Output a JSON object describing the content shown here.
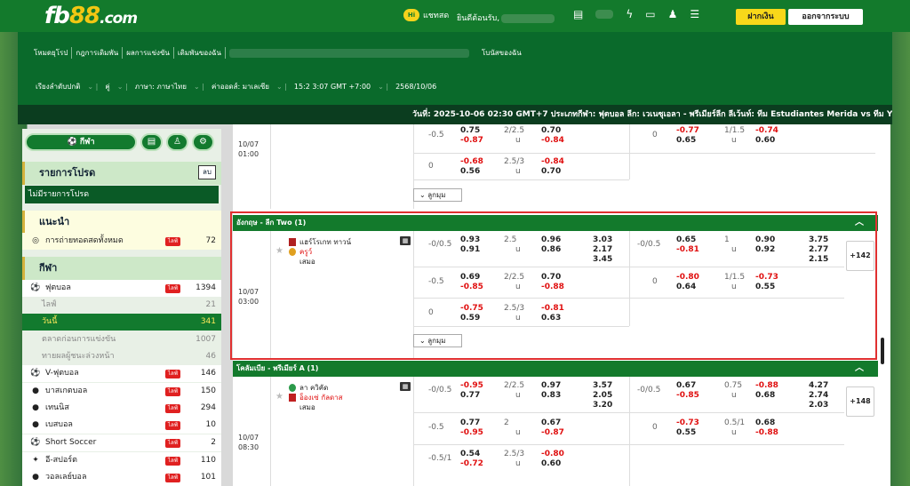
{
  "topbar": {
    "logo_a": "fb",
    "logo_b": "88",
    "logo_c": ".com",
    "chat_label": "แชทสด",
    "chat_badge": "Hi",
    "welcome": "ยินดีต้อนรับ,",
    "deposit": "ฝากเงิน",
    "logout": "ออกจากระบบ"
  },
  "nav": {
    "items": [
      "โหมดยุโรป",
      "กฎการเดิมพัน",
      "ผลการแข่งขัน",
      "เดิมพันของฉัน"
    ],
    "mybets": "โบนัสของฉัน"
  },
  "settings": {
    "sort": "เรียงลำดับปกติ",
    "pair": "คู่",
    "lang": "ภาษา: ภาษาไทย",
    "odds": "ค่าออดส์: มาเลเซีย",
    "clock": "15:2 3:07 GMT +7:00",
    "date": "2568/10/06"
  },
  "ticker": "วันที่: 2025-10-06 02:30 GMT+7 ประเภทกีฬา: ฟุตบอล ลีก: เวเนซุเอลา - พรีเมียร์ลีก ลีเว้นท์: ทีม Estudiantes Merida vs ทีม Yaracuyanos",
  "sidebar": {
    "sport_btn": "กีฬา",
    "fav_title": "รายการโปรด",
    "fav_clear": "ลบ",
    "fav_empty": "ไม่มีรายการโปรด",
    "rec_title": "แนะนำ",
    "rec_item": "การถ่ายทอดสดทั้งหมด",
    "rec_count": "72",
    "live": "ไลฟ์",
    "sports_title": "กีฬา",
    "sports": [
      {
        "name": "ฟุตบอล",
        "count": "1394",
        "live": true,
        "icon": "⚽"
      },
      {
        "name": "ไลฟ์",
        "count": "21",
        "sub": true
      },
      {
        "name": "วันนี้",
        "count": "341",
        "sub": true,
        "active": true
      },
      {
        "name": "ตลาดก่อนการแข่งขัน",
        "count": "1007",
        "sub": true
      },
      {
        "name": "ทายผลผู้ชนะล่วงหน้า",
        "count": "46",
        "sub": true
      },
      {
        "name": "V-ฟุตบอล",
        "count": "146",
        "live": true,
        "icon": "⚽"
      },
      {
        "name": "บาสเกตบอล",
        "count": "150",
        "live": true,
        "icon": "●"
      },
      {
        "name": "เทนนิส",
        "count": "294",
        "live": true,
        "icon": "●"
      },
      {
        "name": "เบสบอล",
        "count": "10",
        "live": true,
        "icon": "●"
      },
      {
        "name": "Short Soccer",
        "count": "2",
        "live": true,
        "icon": "⚽"
      },
      {
        "name": "อี-สปอร์ต",
        "count": "110",
        "live": true,
        "icon": "✦"
      },
      {
        "name": "วอลเลย์บอล",
        "count": "101",
        "live": true,
        "icon": "●"
      }
    ]
  },
  "main": {
    "m0": {
      "date": "10/07",
      "time": "01:00",
      "r1": {
        "hdp": "-0.5",
        "h1": "0.75",
        "h2": "-0.87",
        "ou": "2/2.5",
        "u": "u",
        "o1": "0.70",
        "o2": "-0.84",
        "hdp2": "0",
        "a1": "-0.77",
        "a2": "0.65",
        "ou2": "1/1.5",
        "b1": "-0.74",
        "b2": "0.60"
      },
      "r2": {
        "hdp": "0",
        "h1": "-0.68",
        "h2": "0.56",
        "ou": "2.5/3",
        "u": "u",
        "o1": "-0.84",
        "o2": "0.70"
      },
      "more": "ลูกมุม"
    },
    "l1": {
      "name": "อังกฤษ - ลีก Two (1)"
    },
    "m1": {
      "date": "10/07",
      "time": "03:00",
      "home": "แฮร์โรเกท ทาวน์",
      "away": "ครูว์",
      "draw": "เสมอ",
      "r1": {
        "hdp": "-0/0.5",
        "h1": "0.93",
        "h2": "0.91",
        "ou": "2.5",
        "u": "u",
        "o1": "0.96",
        "o2": "0.86",
        "x1": "3.03",
        "x2": "2.17",
        "x3": "3.45",
        "hdp2": "-0/0.5",
        "a1": "0.65",
        "a2": "-0.81",
        "ou2": "1",
        "b1": "0.90",
        "b2": "0.92",
        "y1": "3.75",
        "y2": "2.77",
        "y3": "2.15",
        "plus": "+142"
      },
      "r2": {
        "hdp": "-0.5",
        "h1": "0.69",
        "h2": "-0.85",
        "ou": "2/2.5",
        "u": "u",
        "o1": "0.70",
        "o2": "-0.88",
        "hdp2": "0",
        "a1": "-0.80",
        "a2": "0.64",
        "ou2": "1/1.5",
        "b1": "-0.73",
        "b2": "0.55"
      },
      "r3": {
        "hdp": "0",
        "h1": "-0.75",
        "h2": "0.59",
        "ou": "2.5/3",
        "u": "u",
        "o1": "-0.81",
        "o2": "0.63"
      },
      "more": "ลูกมุม"
    },
    "l2": {
      "name": "โคลัมเบีย - พรีเมียร์ A (1)"
    },
    "m2": {
      "date": "10/07",
      "time": "08:30",
      "home": "ลา ควิคัด",
      "away": "อ็องเซ่ กัลดาส",
      "draw": "เสมอ",
      "r1": {
        "hdp": "-0/0.5",
        "h1": "-0.95",
        "h2": "0.77",
        "ou": "2/2.5",
        "u": "u",
        "o1": "0.97",
        "o2": "0.83",
        "x1": "3.57",
        "x2": "2.05",
        "x3": "3.20",
        "hdp2": "-0/0.5",
        "a1": "0.67",
        "a2": "-0.85",
        "ou2": "0.75",
        "b1": "-0.88",
        "b2": "0.68",
        "y1": "4.27",
        "y2": "2.74",
        "y3": "2.03",
        "plus": "+148"
      },
      "r2": {
        "hdp": "-0.5",
        "h1": "0.77",
        "h2": "-0.95",
        "ou": "2",
        "u": "u",
        "o1": "0.67",
        "o2": "-0.87",
        "hdp2": "0",
        "a1": "-0.73",
        "a2": "0.55",
        "ou2": "0.5/1",
        "b1": "0.68",
        "b2": "-0.88"
      },
      "r3": {
        "hdp": "-0.5/1",
        "h1": "0.54",
        "h2": "-0.72",
        "ou": "2.5/3",
        "u": "u",
        "o1": "-0.80",
        "o2": "0.60"
      }
    }
  }
}
